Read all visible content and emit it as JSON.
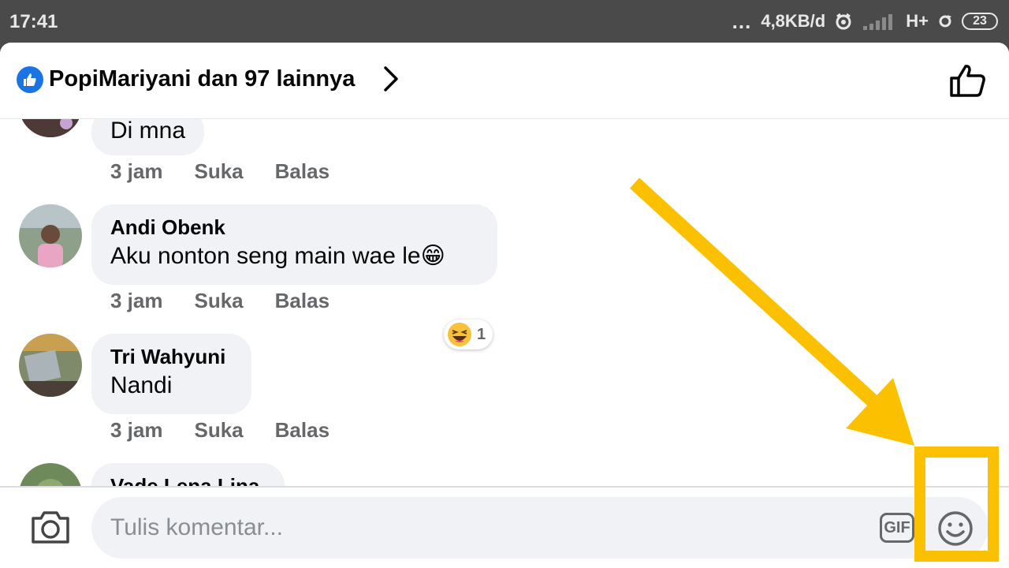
{
  "status_bar": {
    "time": "17:41",
    "dots": "...",
    "speed": "4,8KB/d",
    "network": "H+",
    "battery": "23",
    "icons": [
      "alarm-icon",
      "signal-icon",
      "sync-icon",
      "battery-icon"
    ]
  },
  "header": {
    "title": "PopiMariyani dan 97 lainnya",
    "icons": [
      "like-badge-icon",
      "chevron-right-icon",
      "thumbs-up-icon"
    ]
  },
  "comments": [
    {
      "author": "",
      "text": "Di mna",
      "time": "3 jam",
      "like_label": "Suka",
      "reply_label": "Balas"
    },
    {
      "author": "Andi Obenk",
      "text": "Aku nonton seng main wae le😁",
      "time": "3 jam",
      "like_label": "Suka",
      "reply_label": "Balas",
      "reaction": {
        "emoji": "laughing-face",
        "count": "1"
      }
    },
    {
      "author": "Tri Wahyuni",
      "text": "Nandi",
      "time": "3 jam",
      "like_label": "Suka",
      "reply_label": "Balas"
    },
    {
      "author": "Vade Lena Lina",
      "text": "",
      "time": "",
      "like_label": "",
      "reply_label": ""
    }
  ],
  "composer": {
    "placeholder": "Tulis komentar...",
    "value": "",
    "gif_label": "GIF",
    "icons": [
      "camera-icon",
      "gif-icon",
      "emoji-icon"
    ]
  },
  "colors": {
    "accent_blue": "#1b74e4",
    "annotation_yellow": "#fbc100",
    "bubble_bg": "#f0f2f5",
    "meta_gray": "#65676b"
  }
}
